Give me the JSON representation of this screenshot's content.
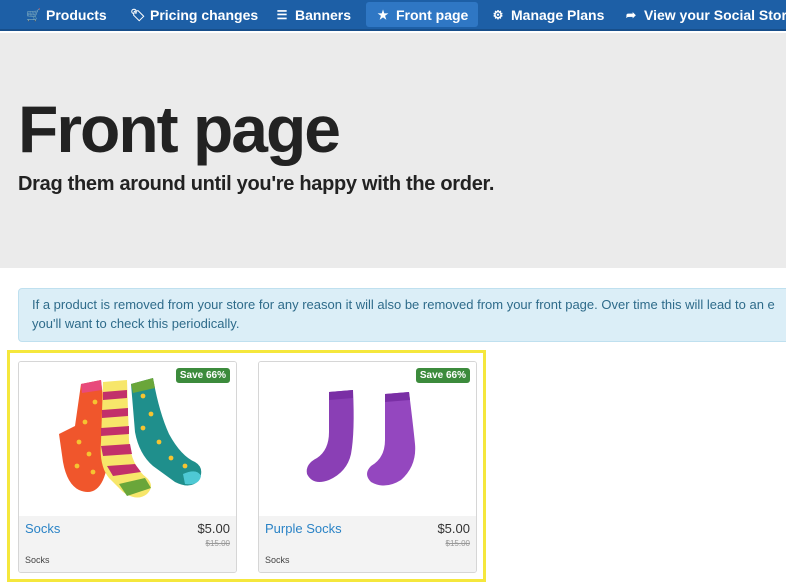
{
  "nav": {
    "items": [
      {
        "label": "Products",
        "icon": "cart-icon",
        "glyph": "🛒"
      },
      {
        "label": "Pricing changes",
        "icon": "tag-icon",
        "glyph": "🏷"
      },
      {
        "label": "Banners",
        "icon": "list-icon",
        "glyph": "☰"
      },
      {
        "label": "Front page",
        "icon": "star-icon",
        "glyph": "★"
      },
      {
        "label": "Manage Plans",
        "icon": "gear-icon",
        "glyph": "⚙"
      },
      {
        "label": "View your Social Store",
        "icon": "share-arrow-icon",
        "glyph": "➦"
      }
    ],
    "active_index": 3,
    "colors": {
      "bar": "#1d5fa6",
      "active": "#2f77c4"
    }
  },
  "hero": {
    "title": "Front page",
    "subtitle": "Drag them around until you're happy with the order."
  },
  "alert": {
    "line1": "If a product is removed from your store for any reason it will also be removed from your front page. Over time this will lead to an e",
    "line2": "you'll want to check this periodically."
  },
  "products": [
    {
      "name": "Socks",
      "price": "$5.00",
      "old_price": "$15.00",
      "category": "Socks",
      "badge": "Save 66%"
    },
    {
      "name": "Purple Socks",
      "price": "$5.00",
      "old_price": "$15.00",
      "category": "Socks",
      "badge": "Save 66%"
    }
  ],
  "colors": {
    "highlight_border": "#f5e73c",
    "badge": "#3c8b3c",
    "link": "#2a83c6"
  }
}
